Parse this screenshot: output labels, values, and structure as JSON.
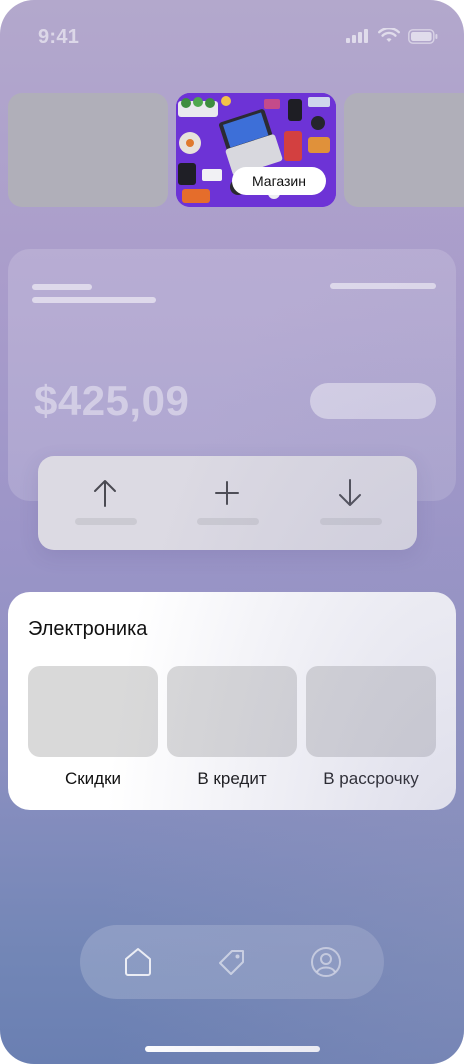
{
  "status_bar": {
    "time": "9:41"
  },
  "carousel": {
    "store_tile": {
      "label": "Магазин"
    }
  },
  "balance": {
    "amount": "$425,09"
  },
  "actions": [
    {
      "icon": "arrow-up-icon"
    },
    {
      "icon": "plus-icon"
    },
    {
      "icon": "arrow-down-icon"
    }
  ],
  "electronics": {
    "title": "Электроника",
    "categories": [
      {
        "label": "Скидки"
      },
      {
        "label": "В кредит"
      },
      {
        "label": "В рассрочку"
      }
    ]
  },
  "bottom_nav": {
    "items": [
      {
        "icon": "home-icon"
      },
      {
        "icon": "tag-icon"
      },
      {
        "icon": "profile-icon"
      }
    ]
  },
  "colors": {
    "store_tile_bg": "#6d33d6",
    "card_bg": "#ffffff",
    "placeholder": "#d9d9d9"
  }
}
